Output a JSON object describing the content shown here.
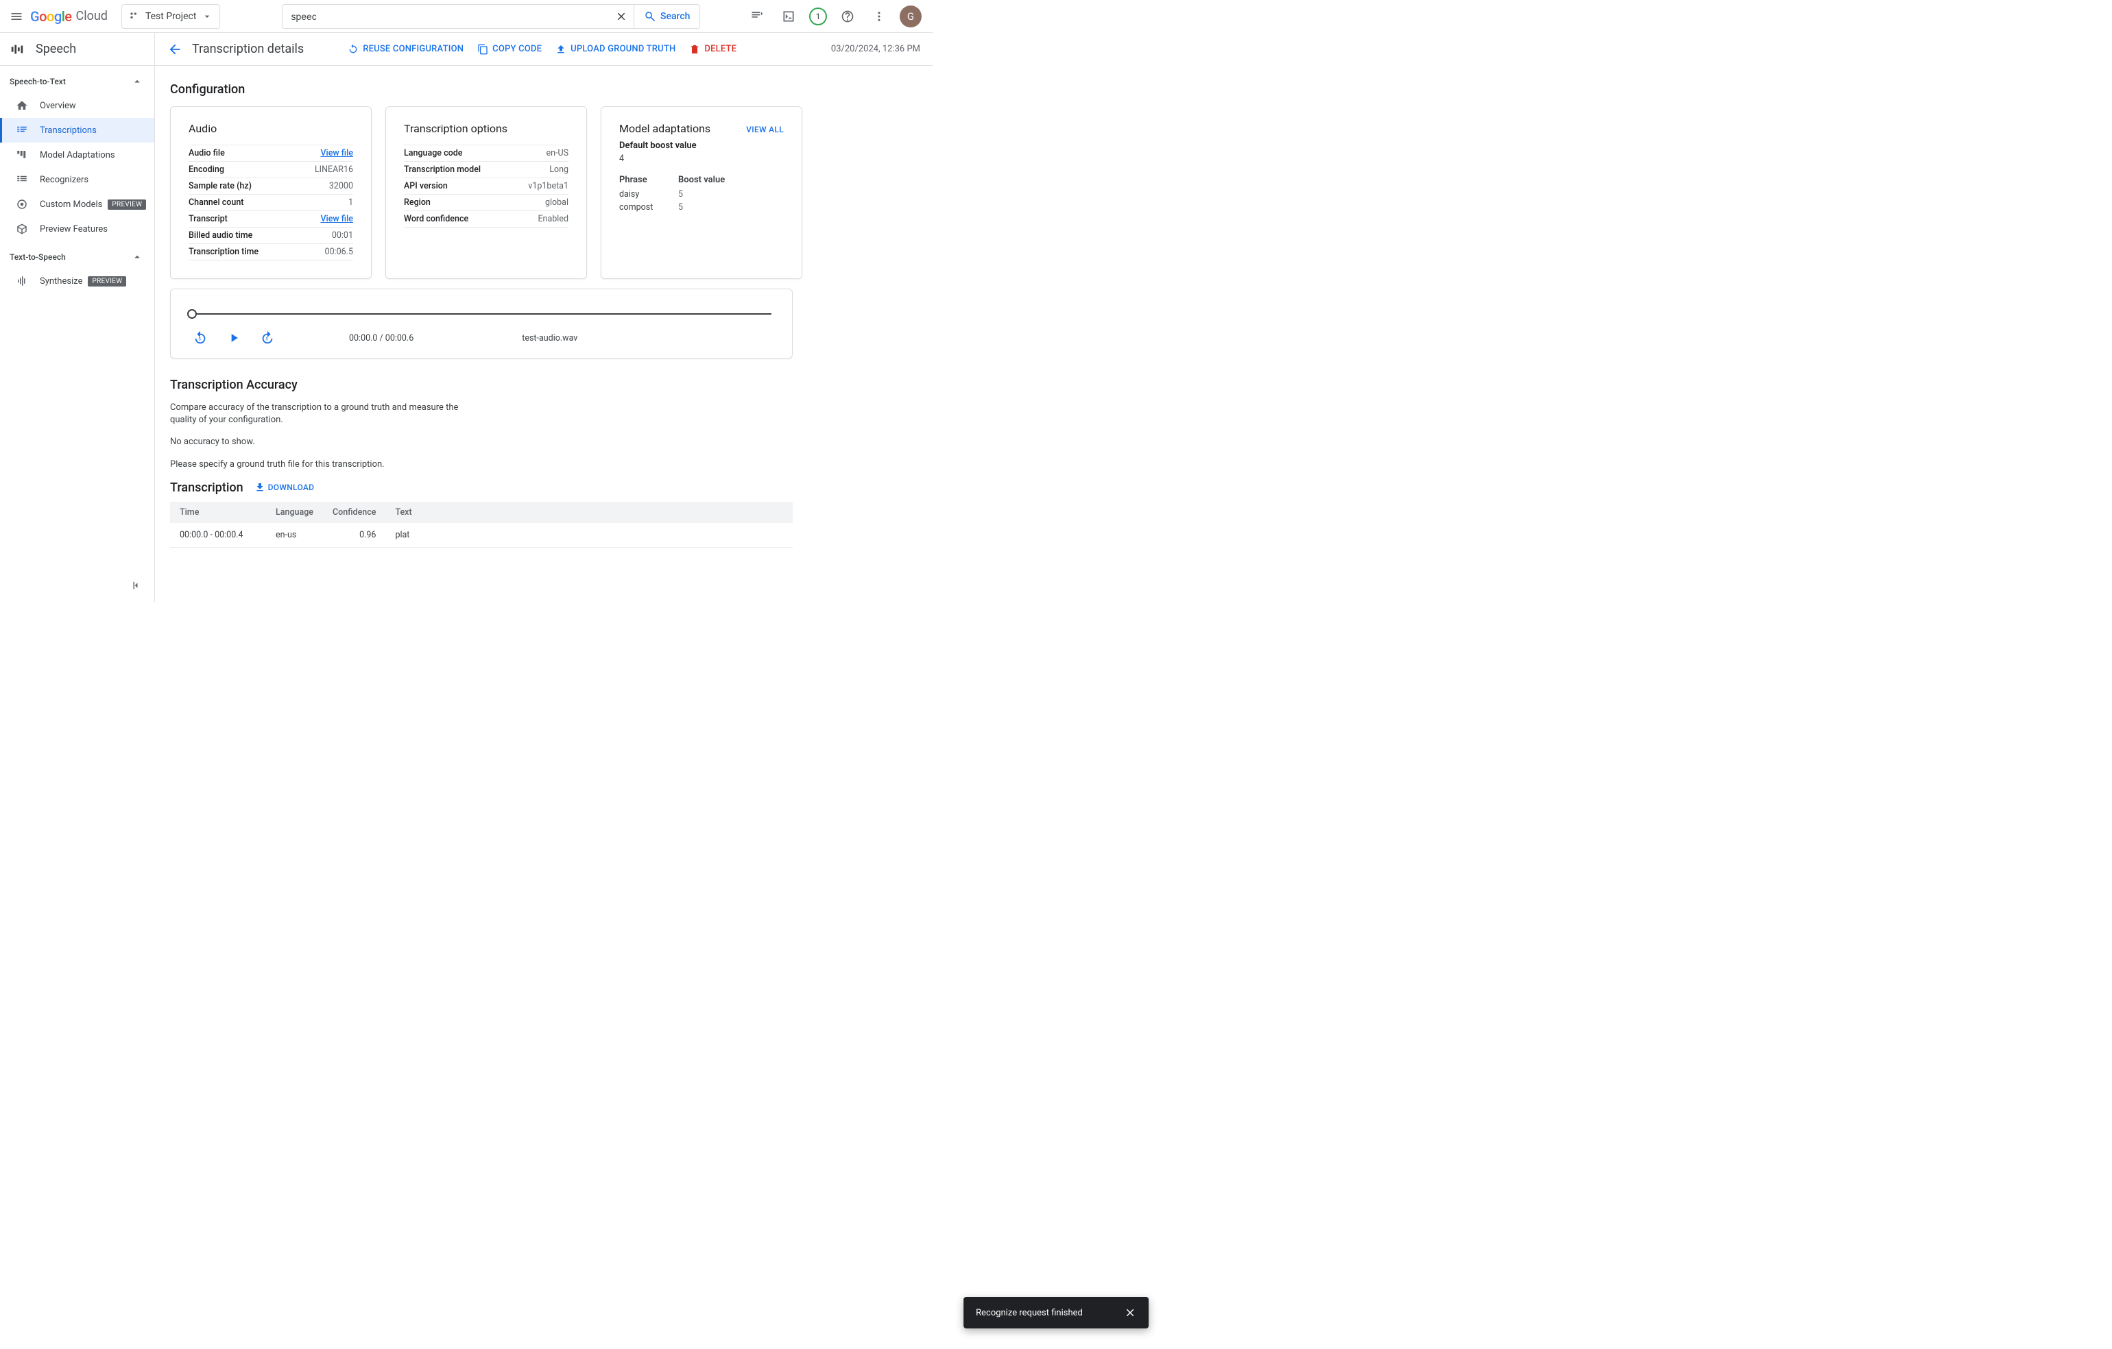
{
  "header": {
    "project_name": "Test Project",
    "search_value": "speec",
    "search_button": "Search",
    "notif_count": "1",
    "avatar_letter": "G"
  },
  "sidebar": {
    "product": "Speech",
    "stt_label": "Speech-to-Text",
    "tts_label": "Text-to-Speech",
    "stt_items": [
      {
        "label": "Overview"
      },
      {
        "label": "Transcriptions"
      },
      {
        "label": "Model Adaptations"
      },
      {
        "label": "Recognizers"
      },
      {
        "label": "Custom Models"
      },
      {
        "label": "Preview Features"
      }
    ],
    "tts_items": [
      {
        "label": "Synthesize"
      }
    ],
    "preview_chip": "PREVIEW"
  },
  "pagebar": {
    "title": "Transcription details",
    "reuse": "REUSE CONFIGURATION",
    "copy": "COPY CODE",
    "upload": "UPLOAD GROUND TRUTH",
    "delete": "DELETE",
    "timestamp": "03/20/2024, 12:36 PM"
  },
  "config": {
    "heading": "Configuration",
    "audio": {
      "title": "Audio",
      "rows": {
        "audio_file_k": "Audio file",
        "audio_file_v": "View file",
        "encoding_k": "Encoding",
        "encoding_v": "LINEAR16",
        "sample_k": "Sample rate (hz)",
        "sample_v": "32000",
        "channel_k": "Channel count",
        "channel_v": "1",
        "transcript_k": "Transcript",
        "transcript_v": "View file",
        "billed_k": "Billed audio time",
        "billed_v": "00:01",
        "trtime_k": "Transcription time",
        "trtime_v": "00:06.5"
      }
    },
    "options": {
      "title": "Transcription options",
      "rows": {
        "lang_k": "Language code",
        "lang_v": "en-US",
        "model_k": "Transcription model",
        "model_v": "Long",
        "api_k": "API version",
        "api_v": "v1p1beta1",
        "region_k": "Region",
        "region_v": "global",
        "conf_k": "Word confidence",
        "conf_v": "Enabled"
      }
    },
    "adapt": {
      "title": "Model adaptations",
      "view_all": "VIEW ALL",
      "boost_label": "Default boost value",
      "boost_value": "4",
      "col_phrase": "Phrase",
      "col_boost": "Boost value",
      "rows": [
        {
          "phrase": "daisy",
          "boost": "5"
        },
        {
          "phrase": "compost",
          "boost": "5"
        }
      ]
    }
  },
  "player": {
    "time": "00:00.0 / 00:00.6",
    "file": "test-audio.wav"
  },
  "accuracy": {
    "heading": "Transcription Accuracy",
    "desc": "Compare accuracy of the transcription to a ground truth and measure the quality of your configuration.",
    "none": "No accuracy to show.",
    "hint": "Please specify a ground truth file for this transcription."
  },
  "transcription": {
    "heading": "Transcription",
    "download": "DOWNLOAD",
    "cols": {
      "time": "Time",
      "lang": "Language",
      "conf": "Confidence",
      "text": "Text"
    },
    "rows": [
      {
        "time": "00:00.0 - 00:00.4",
        "lang": "en-us",
        "conf": "0.96",
        "text": "plat"
      }
    ]
  },
  "toast": {
    "msg": "Recognize request finished"
  }
}
